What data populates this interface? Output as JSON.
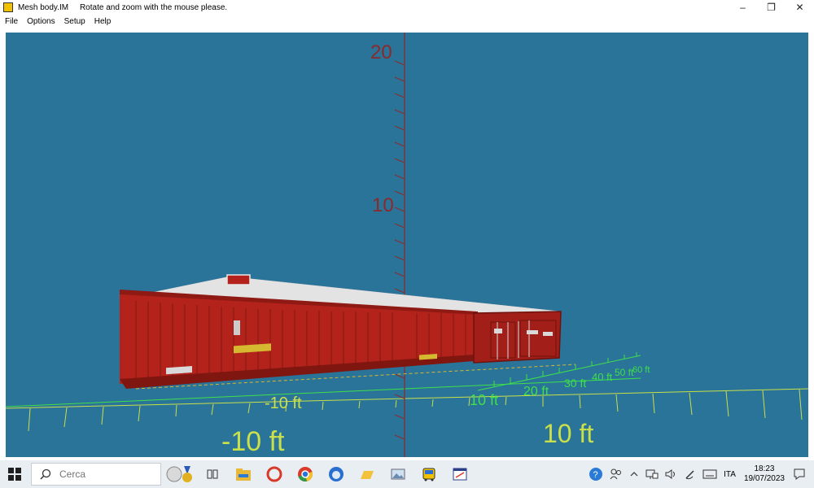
{
  "window": {
    "title": "Mesh body.IM     Rotate and zoom with the mouse please.",
    "minimize": "–",
    "restore": "❐",
    "close": "✕"
  },
  "menu": [
    "File",
    "Options",
    "Setup",
    "Help"
  ],
  "scene": {
    "background": "#2a7399",
    "vertical_axis_labels": [
      "20",
      "10"
    ],
    "grid_labels_green": [
      "-10 ft",
      "10 ft",
      "20 ft",
      "30 ft",
      "40 ft",
      "50 ft",
      "60 ft"
    ],
    "grid_labels_yellow": [
      "-10 ft",
      "10 ft"
    ],
    "grid_labels_large": [
      "-10 ft",
      "10 ft"
    ],
    "container_color": "#b3231b",
    "roof_color": "#e8e8e8",
    "axis_color": "#8b2a2a",
    "grid_color_yellow": "#c9e04a",
    "grid_color_green": "#3fe04a"
  },
  "taskbar": {
    "search_placeholder": "Cerca",
    "language": "ITA",
    "time": "18:23",
    "date": "19/07/2023",
    "icons": [
      "task-view-icon",
      "file-explorer-icon",
      "ccleaner-icon",
      "chrome-icon",
      "thunderbird-icon",
      "folder-icon",
      "photos-icon",
      "bus-app-icon",
      "editor-app-icon"
    ]
  }
}
